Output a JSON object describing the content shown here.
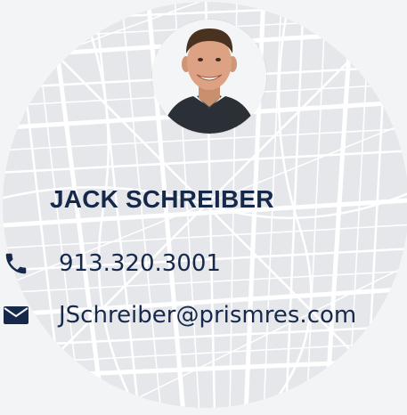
{
  "contact": {
    "name": "JACK SCHREIBER",
    "phone": "913.320.3001",
    "email": "JSchreiber@prismres.com"
  },
  "icons": {
    "phone": "phone-icon",
    "email": "envelope-icon"
  },
  "colors": {
    "text": "#16294a",
    "background": "#f3f4f6",
    "map": "#e6e8ec"
  }
}
